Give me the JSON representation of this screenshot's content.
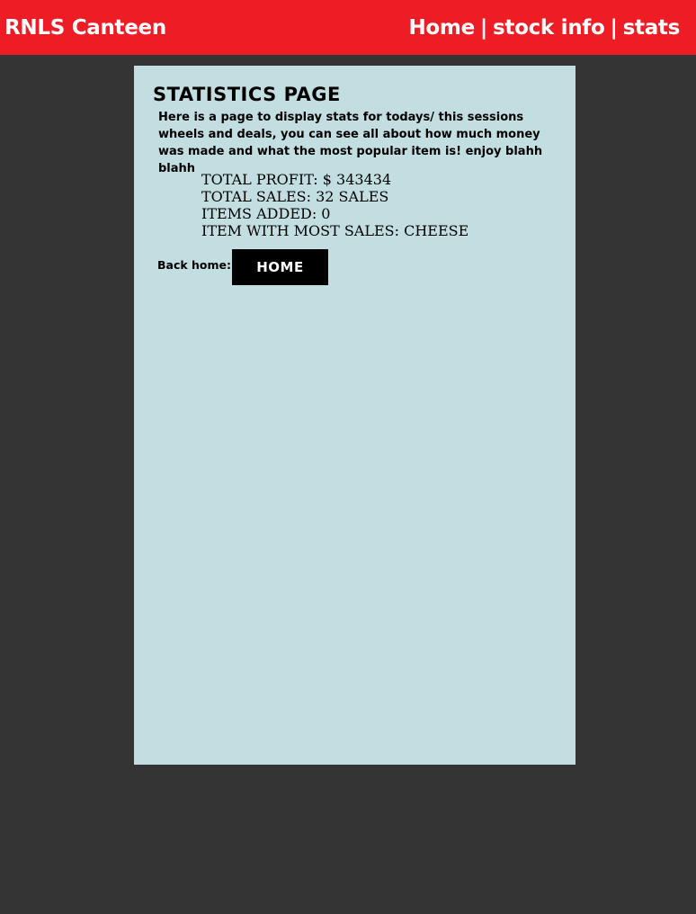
{
  "header": {
    "brand": "RNLS Canteen",
    "nav": {
      "home": "Home",
      "separator": "|",
      "stock_info": "stock info",
      "stats": "stats"
    }
  },
  "page": {
    "title": "STATISTICS PAGE",
    "intro": "Here is a page to display stats for todays/ this sessions wheels and deals, you can see all about how much money was made and what the most popular item is! enjoy blahh blahh",
    "stats": {
      "total_profit": "TOTAL PROFIT: $ 343434",
      "total_sales": "TOTAL SALES: 32 SALES",
      "items_added": "ITEMS ADDED: 0",
      "most_sales": "ITEM WITH MOST SALES: CHEESE"
    },
    "back_label": "Back home:",
    "home_button": "HOME"
  },
  "colors": {
    "background": "#343434",
    "header": "#ee1c25",
    "panel": "#c3dee1",
    "button": "#000000"
  }
}
